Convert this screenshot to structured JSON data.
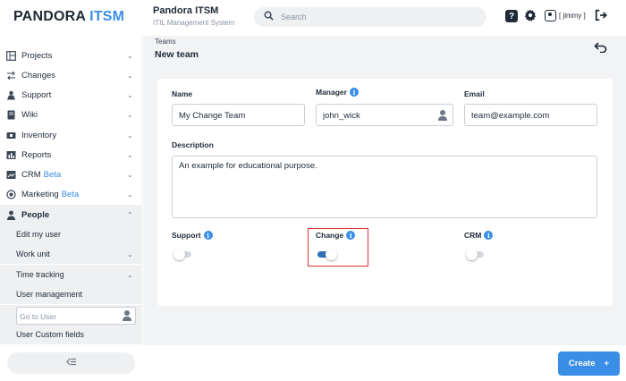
{
  "header": {
    "logo_main": "PANDORA",
    "logo_accent": "ITSM",
    "app_title": "Pandora ITSM",
    "app_subtitle": "ITIL Management System",
    "search_placeholder": "Search",
    "help_icon": "?",
    "username": "[ jimmy ]"
  },
  "sidebar": {
    "items": [
      {
        "label": "Projects",
        "icon": "projects-icon"
      },
      {
        "label": "Changes",
        "icon": "changes-icon"
      },
      {
        "label": "Support",
        "icon": "support-icon"
      },
      {
        "label": "Wiki",
        "icon": "wiki-icon"
      },
      {
        "label": "Inventory",
        "icon": "inventory-icon"
      },
      {
        "label": "Reports",
        "icon": "reports-icon"
      },
      {
        "label": "CRM",
        "beta": "Beta",
        "icon": "crm-icon"
      },
      {
        "label": "Marketing",
        "beta": "Beta",
        "icon": "marketing-icon"
      },
      {
        "label": "People",
        "icon": "people-icon"
      }
    ],
    "sub_items": [
      "Edit my user",
      "Work unit",
      "Time tracking",
      "User management"
    ],
    "goto_placeholder": "Go to User",
    "last_item": "User Custom fields"
  },
  "main": {
    "breadcrumb": "Teams",
    "title": "New team",
    "form": {
      "name_label": "Name",
      "name_value": "My Change Team",
      "manager_label": "Manager",
      "manager_value": "john_wick",
      "email_label": "Email",
      "email_value": "team@example.com",
      "description_label": "Description",
      "description_value": "An example for educational purpose.",
      "support_label": "Support",
      "support_on": false,
      "change_label": "Change",
      "change_on": true,
      "crm_label": "CRM",
      "crm_on": false
    }
  },
  "footer": {
    "create_label": "Create",
    "create_icon": "+"
  },
  "colors": {
    "accent": "#3a8ee6",
    "toggle_on": "#2f6fb5",
    "highlight": "#e03131"
  }
}
